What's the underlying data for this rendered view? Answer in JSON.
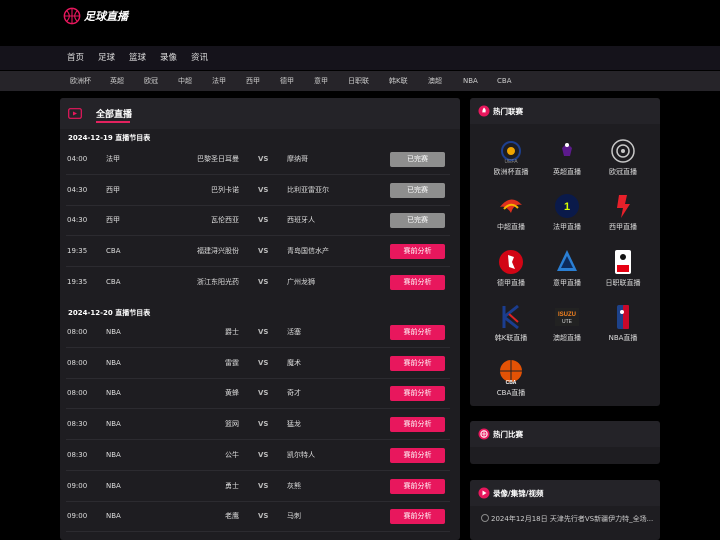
{
  "site": {
    "logo_text": "足球直播"
  },
  "main_nav": [
    "首页",
    "足球",
    "篮球",
    "录像",
    "资讯"
  ],
  "league_nav": [
    "欧洲杯",
    "英超",
    "欧冠",
    "中超",
    "法甲",
    "西甲",
    "德甲",
    "意甲",
    "日职联",
    "韩K联",
    "澳超",
    "NBA",
    "CBA"
  ],
  "left_panel": {
    "title": "全部直播",
    "days": [
      {
        "header": "2024-12-19 直播节目表",
        "matches": [
          {
            "time": "04:00",
            "league": "法甲",
            "home": "巴黎圣日耳曼",
            "vs": "VS",
            "away": "摩纳哥",
            "button": "已完赛",
            "state": "done"
          },
          {
            "time": "04:30",
            "league": "西甲",
            "home": "巴列卡诺",
            "vs": "VS",
            "away": "比利亚雷亚尔",
            "button": "已完赛",
            "state": "done"
          },
          {
            "time": "04:30",
            "league": "西甲",
            "home": "瓦伦西亚",
            "vs": "VS",
            "away": "西班牙人",
            "button": "已完赛",
            "state": "done"
          },
          {
            "time": "19:35",
            "league": "CBA",
            "home": "福建浔兴股份",
            "vs": "VS",
            "away": "青岛国信水产",
            "button": "赛前分析",
            "state": "pre"
          },
          {
            "time": "19:35",
            "league": "CBA",
            "home": "浙江东阳光药",
            "vs": "VS",
            "away": "广州龙狮",
            "button": "赛前分析",
            "state": "pre"
          }
        ]
      },
      {
        "header": "2024-12-20 直播节目表",
        "matches": [
          {
            "time": "08:00",
            "league": "NBA",
            "home": "爵士",
            "vs": "VS",
            "away": "活塞",
            "button": "赛前分析",
            "state": "pre"
          },
          {
            "time": "08:00",
            "league": "NBA",
            "home": "雷霆",
            "vs": "VS",
            "away": "魔术",
            "button": "赛前分析",
            "state": "pre"
          },
          {
            "time": "08:00",
            "league": "NBA",
            "home": "黄蜂",
            "vs": "VS",
            "away": "奇才",
            "button": "赛前分析",
            "state": "pre"
          },
          {
            "time": "08:30",
            "league": "NBA",
            "home": "篮网",
            "vs": "VS",
            "away": "猛龙",
            "button": "赛前分析",
            "state": "pre"
          },
          {
            "time": "08:30",
            "league": "NBA",
            "home": "公牛",
            "vs": "VS",
            "away": "凯尔特人",
            "button": "赛前分析",
            "state": "pre"
          },
          {
            "time": "09:00",
            "league": "NBA",
            "home": "勇士",
            "vs": "VS",
            "away": "灰熊",
            "button": "赛前分析",
            "state": "pre"
          },
          {
            "time": "09:00",
            "league": "NBA",
            "home": "老鹰",
            "vs": "VS",
            "away": "马刺",
            "button": "赛前分析",
            "state": "pre"
          }
        ]
      }
    ]
  },
  "hot_leagues": {
    "title": "热门联赛",
    "items": [
      {
        "label": "欧洲杯直播",
        "icon": "euro-cup-icon",
        "color": "#1d3f8f"
      },
      {
        "label": "英超直播",
        "icon": "premier-league-icon",
        "color": "#5c1a8c"
      },
      {
        "label": "欧冠直播",
        "icon": "champions-league-icon",
        "color": "#c8c8c8"
      },
      {
        "label": "中超直播",
        "icon": "chinese-super-league-icon",
        "color": "#e0301e"
      },
      {
        "label": "法甲直播",
        "icon": "ligue1-icon",
        "color": "#d7ff00"
      },
      {
        "label": "西甲直播",
        "icon": "laliga-icon",
        "color": "#e8202a"
      },
      {
        "label": "德甲直播",
        "icon": "bundesliga-icon",
        "color": "#d20515"
      },
      {
        "label": "意甲直播",
        "icon": "serie-a-icon",
        "color": "#2a7fd4"
      },
      {
        "label": "日职联直播",
        "icon": "j-league-icon",
        "color": "#e60012"
      },
      {
        "label": "韩K联直播",
        "icon": "k-league-icon",
        "color": "#1b3d8f"
      },
      {
        "label": "澳超直播",
        "icon": "a-league-icon",
        "color": "#f58220"
      },
      {
        "label": "NBA直播",
        "icon": "nba-icon",
        "color": "#1d428a"
      },
      {
        "label": "CBA直播",
        "icon": "cba-icon",
        "color": "#e35205"
      }
    ]
  },
  "hot_matches": {
    "title": "热门比赛"
  },
  "videos": {
    "title": "录像/集锦/视频",
    "items": [
      "2024年12月18日 天津先行者VS新疆伊力特_全场..."
    ]
  },
  "colors": {
    "accent": "#e8175d",
    "done": "#8e8e8e",
    "panel": "#1e1d21"
  }
}
